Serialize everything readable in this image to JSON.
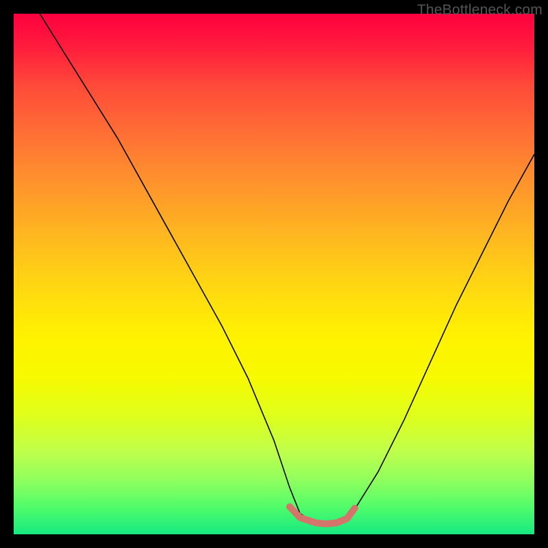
{
  "watermark": "TheBottleneck.com",
  "chart_data": {
    "type": "line",
    "title": "",
    "xlabel": "",
    "ylabel": "",
    "xlim": [
      0,
      100
    ],
    "ylim": [
      0,
      100
    ],
    "grid": false,
    "legend": false,
    "background_gradient": {
      "orientation": "vertical",
      "stops": [
        {
          "pos": 0.0,
          "color": "#ff0040"
        },
        {
          "pos": 0.3,
          "color": "#ff8a2f"
        },
        {
          "pos": 0.62,
          "color": "#fff200"
        },
        {
          "pos": 0.9,
          "color": "#8cff60"
        },
        {
          "pos": 1.0,
          "color": "#17e881"
        }
      ]
    },
    "series": [
      {
        "name": "bottleneck-curve",
        "color": "#000000",
        "width": 1.5,
        "x": [
          5,
          10,
          15,
          20,
          25,
          30,
          35,
          40,
          45,
          50,
          53,
          55,
          58,
          62,
          65,
          70,
          75,
          80,
          85,
          90,
          95,
          100
        ],
        "y": [
          100,
          92,
          84,
          76,
          67,
          58,
          49,
          40,
          30,
          18,
          9,
          4,
          2,
          2,
          4,
          12,
          22,
          33,
          44,
          54,
          64,
          73
        ]
      },
      {
        "name": "optimal-range-marker",
        "color": "#d4756b",
        "width": 10,
        "capped": true,
        "x": [
          53,
          55,
          58,
          60,
          62,
          64,
          65.5
        ],
        "y": [
          5.3,
          3.2,
          2.2,
          2.0,
          2.2,
          3.0,
          5.0
        ]
      }
    ]
  }
}
